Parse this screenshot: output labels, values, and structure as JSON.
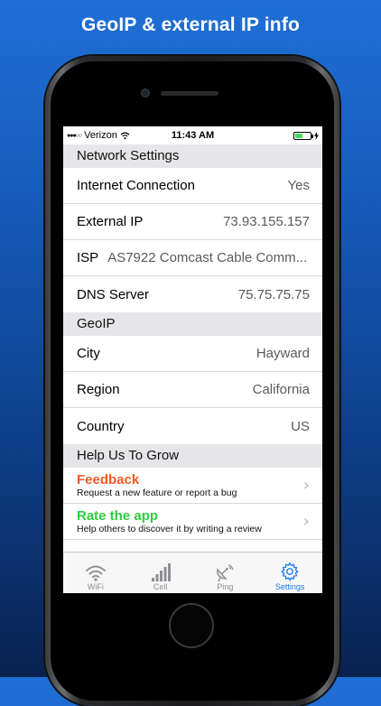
{
  "headline": "GeoIP & external IP info",
  "status_bar": {
    "carrier": "Verizon",
    "time": "11:43 AM"
  },
  "colors": {
    "feedback": "#f15a22",
    "rate": "#2ecc40",
    "active_tab": "#1c7cf4"
  },
  "sections": {
    "network": {
      "title": "Network Settings",
      "rows": [
        {
          "label": "Internet Connection",
          "value": "Yes"
        },
        {
          "label": "External IP",
          "value": "73.93.155.157"
        },
        {
          "label": "ISP",
          "value": "AS7922 Comcast Cable Comm..."
        },
        {
          "label": "DNS Server",
          "value": "75.75.75.75"
        }
      ]
    },
    "geoip": {
      "title": "GeoIP",
      "rows": [
        {
          "label": "City",
          "value": "Hayward"
        },
        {
          "label": "Region",
          "value": "California"
        },
        {
          "label": "Country",
          "value": "US"
        }
      ]
    },
    "grow": {
      "title": "Help Us To Grow",
      "links": [
        {
          "title": "Feedback",
          "subtitle": "Request a new feature or report a bug"
        },
        {
          "title": "Rate the app",
          "subtitle": "Help others to discover it by writing a review"
        }
      ]
    }
  },
  "tabs": [
    {
      "label": "WiFi",
      "icon": "wifi-icon"
    },
    {
      "label": "Cell",
      "icon": "signal-bars-icon"
    },
    {
      "label": "Ping",
      "icon": "satellite-dish-icon"
    },
    {
      "label": "Settings",
      "icon": "gear-icon",
      "active": true
    }
  ]
}
